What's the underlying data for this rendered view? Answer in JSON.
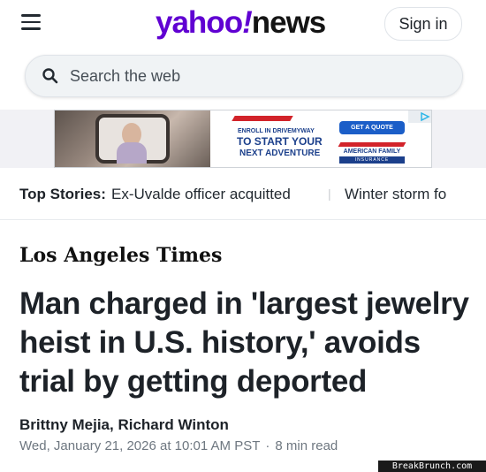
{
  "header": {
    "logo_yahoo": "yahoo",
    "logo_bang": "!",
    "logo_news": "news",
    "signin_label": "Sign in",
    "menu_icon": "hamburger-menu-icon"
  },
  "search": {
    "placeholder": "Search the web",
    "icon": "search-icon"
  },
  "ad": {
    "line1": "ENROLL IN DRIVEMYWAY",
    "line2a": "TO START YOUR",
    "line2b": "NEXT ADVENTURE",
    "cta": "GET A QUOTE",
    "brand": "AMERICAN FAMILY",
    "brand_sub": "INSURANCE"
  },
  "top_stories": {
    "label": "Top Stories:",
    "items": [
      "Ex-Uvalde officer acquitted",
      "Winter storm fo"
    ],
    "separator": "|"
  },
  "article": {
    "publisher": "Los Angeles Times",
    "headline": "Man charged in 'largest jewelry heist in U.S. history,' avoids trial by getting deported",
    "authors": "Brittny Mejia, Richard Winton",
    "date": "Wed, January 21, 2026 at 10:01 AM PST",
    "separator": "·",
    "read_time": "8 min read"
  },
  "watermark": "BreakBrunch.com",
  "colors": {
    "yahoo_purple": "#6001d2",
    "text": "#1d2228",
    "meta_gray": "#6e7780"
  }
}
